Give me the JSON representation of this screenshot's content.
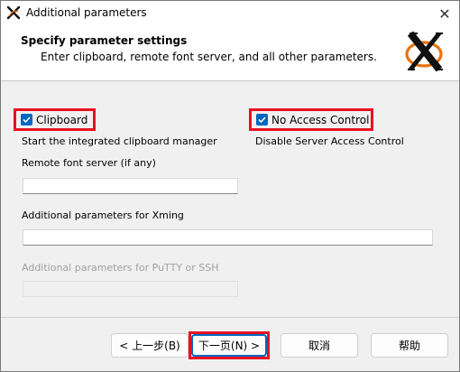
{
  "window": {
    "title": "Additional parameters",
    "close_symbol": "✕"
  },
  "header": {
    "title": "Specify parameter settings",
    "subtitle": "Enter clipboard, remote font server, and all other parameters.",
    "logo_icon": "x-logo-icon"
  },
  "options": {
    "clipboard": {
      "label": "Clipboard",
      "checked": true,
      "description": "Start the integrated clipboard manager"
    },
    "no_access_control": {
      "label": "No Access Control",
      "checked": true,
      "description": "Disable Server Access Control"
    }
  },
  "fields": {
    "font_server": {
      "label": "Remote font server (if any)",
      "value": ""
    },
    "xming_params": {
      "label": "Additional parameters for Xming",
      "value": ""
    },
    "putty_params": {
      "label": "Additional parameters for PuTTY or SSH",
      "value": "",
      "disabled": true
    }
  },
  "buttons": {
    "back": "< 上一步(B)",
    "next": "下一页(N) >",
    "cancel": "取消",
    "help": "帮助"
  },
  "colors": {
    "accent": "#0067c0",
    "highlight": "#e81123"
  }
}
